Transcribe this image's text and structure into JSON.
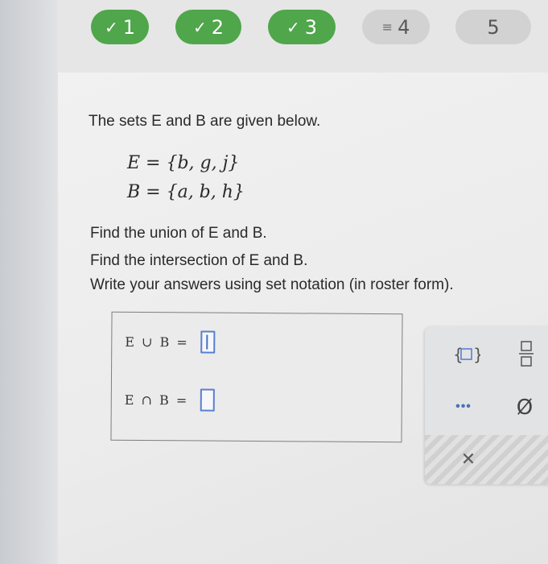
{
  "steps": [
    {
      "label": "1",
      "icon": "checkmark-icon",
      "symbol": "✓",
      "status": "done"
    },
    {
      "label": "2",
      "icon": "checkmark-icon",
      "symbol": "✓",
      "status": "done"
    },
    {
      "label": "3",
      "icon": "checkmark-icon",
      "symbol": "✓",
      "status": "done"
    },
    {
      "label": "4",
      "icon": "equals-icon",
      "symbol": "≡",
      "status": "current"
    },
    {
      "label": "5",
      "icon": "",
      "symbol": "",
      "status": "todo"
    }
  ],
  "problem": {
    "intro": "The sets E and B are given below.",
    "set_e": "E = {b, g, j}",
    "set_b": "B = {a, b, h}",
    "instructions": [
      "Find the union of E and B.",
      "Find the intersection of E and B.",
      "Write your answers using set notation (in roster form)."
    ]
  },
  "answers": {
    "union_label": "E ∪ B =",
    "union_value": "",
    "intersection_label": "E ∩ B =",
    "intersection_value": ""
  },
  "tools": {
    "set_braces_icon": "set-braces-icon",
    "fraction_icon": "fraction-icon",
    "more_label": "•••",
    "empty_set_label": "Ø",
    "close_label": "✕"
  },
  "colors": {
    "done": "#4fa64b",
    "inactive": "#d2d2d2",
    "input_border": "#5a7fd0"
  }
}
